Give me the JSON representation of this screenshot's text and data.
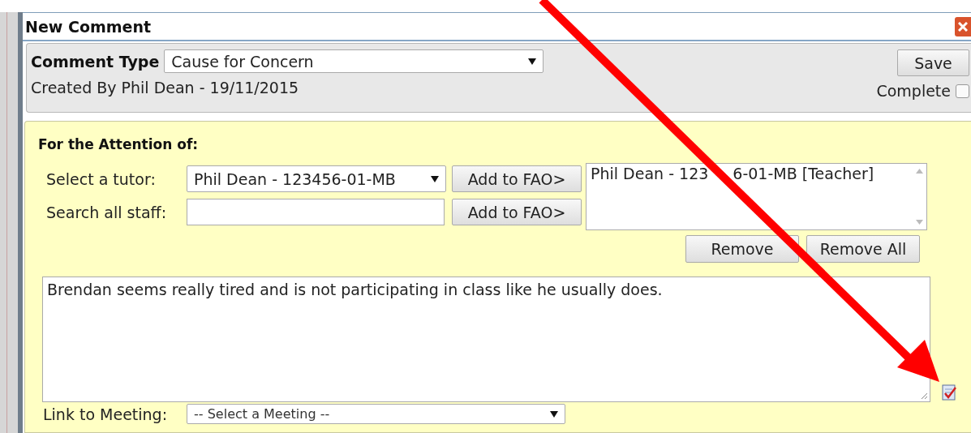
{
  "dialog": {
    "title": "New Comment"
  },
  "header": {
    "comment_type_label": "Comment Type",
    "comment_type": "Cause for Concern",
    "created_by": "Created By Phil Dean - 19/11/2015",
    "save_button": "Save",
    "complete_label": "Complete",
    "complete_checked": false
  },
  "fao": {
    "heading": "For the Attention of:",
    "tutor_label": "Select a tutor:",
    "tutor_value": "Phil Dean - 123456-01-MB",
    "add_button": "Add to FAO>",
    "search_label": "Search all staff:",
    "search_add_button": "Add to FAO>",
    "recipients": [
      {
        "text_before_arrow": "Phil Dean - 123",
        "text_after_arrow": "6-01-MB [Teacher]",
        "selected": false
      }
    ],
    "remove_button": "Remove",
    "remove_all_button": "Remove All"
  },
  "comment_text": "Brendan seems really tired and is not participating in class like he usually does.",
  "meeting": {
    "label": "Link to Meeting:",
    "placeholder": "-- Select a Meeting --"
  }
}
